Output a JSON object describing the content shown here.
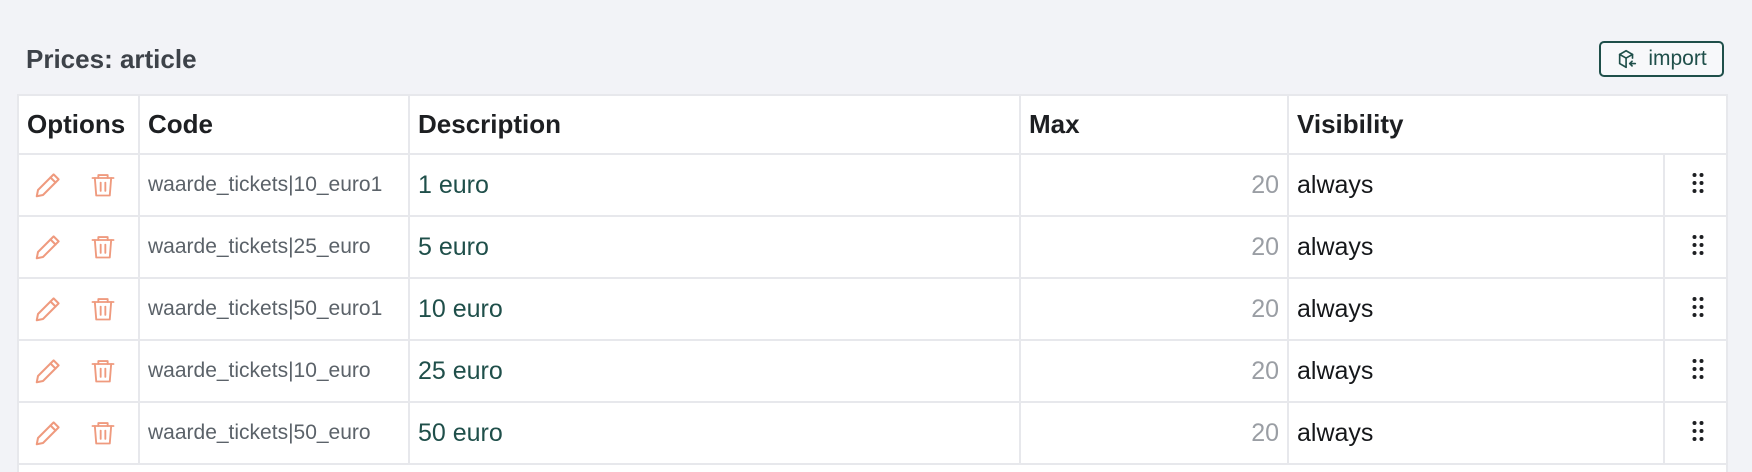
{
  "header": {
    "title": "Prices: article",
    "import_label": "import"
  },
  "table": {
    "columns": [
      "Options",
      "Code",
      "Description",
      "Max",
      "Visibility"
    ],
    "rows": [
      {
        "code": "waarde_tickets|10_euro1",
        "description": "1 euro",
        "max": "20",
        "visibility": "always"
      },
      {
        "code": "waarde_tickets|25_euro",
        "description": "5 euro",
        "max": "20",
        "visibility": "always"
      },
      {
        "code": "waarde_tickets|50_euro1",
        "description": "10 euro",
        "max": "20",
        "visibility": "always"
      },
      {
        "code": "waarde_tickets|10_euro",
        "description": "25 euro",
        "max": "20",
        "visibility": "always"
      },
      {
        "code": "waarde_tickets|50_euro",
        "description": "50 euro",
        "max": "20",
        "visibility": "always"
      }
    ]
  },
  "icons": {
    "edit": "pencil-icon",
    "delete": "trash-icon",
    "drag": "drag-handle-icon",
    "import": "cube-arrow-icon"
  },
  "colors": {
    "accent": "#1f4f4a",
    "action_icon": "#ef9a7e",
    "background": "#f2f3f7"
  }
}
